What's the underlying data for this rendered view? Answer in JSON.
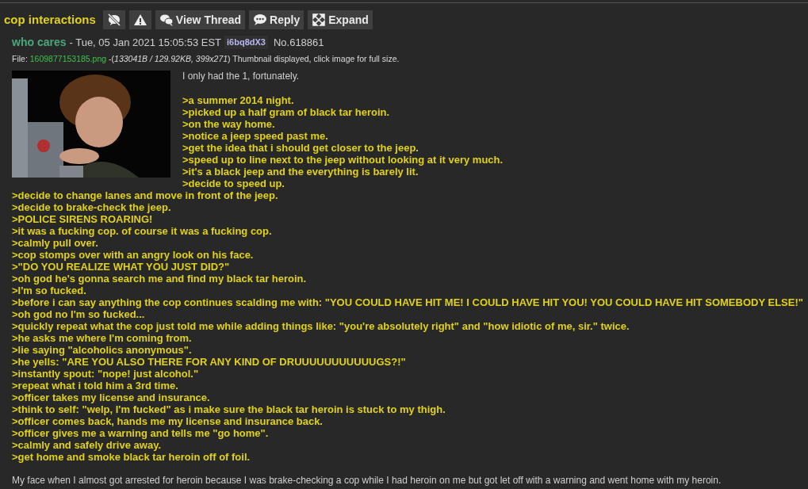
{
  "thread_title": "cop interactions",
  "buttons": [
    {
      "kind": "hide"
    },
    {
      "kind": "report"
    },
    {
      "kind": "thread",
      "label": "View Thread"
    },
    {
      "kind": "reply",
      "label": "Reply"
    },
    {
      "kind": "expand",
      "label": "Expand"
    }
  ],
  "post": {
    "name": "who cares",
    "date": "- Tue, 05 Jan 2021 15:05:53 EST",
    "poster_id": "i6bq8dX3",
    "number": "No.618861",
    "file": {
      "prefix": "File: ",
      "filename": "1609877153185.png",
      "info": "-(*133041B / 129.92KB, 399x271*) Thumbnail displayed, click image for full size."
    },
    "lines": [
      {
        "kind": "text",
        "text": "I only had the 1, fortunately."
      },
      {
        "kind": "blank"
      },
      {
        "kind": "quote",
        "text": ">a summer 2014 night."
      },
      {
        "kind": "quote",
        "text": ">picked up a half gram of black tar heroin."
      },
      {
        "kind": "quote",
        "text": ">on the way home."
      },
      {
        "kind": "quote",
        "text": ">notice a jeep speed past me."
      },
      {
        "kind": "quote",
        "text": ">get the idea that i should get closer to the jeep."
      },
      {
        "kind": "quote",
        "text": ">speed up to line next to the jeep without looking at it very much."
      },
      {
        "kind": "quote",
        "text": ">it's a black jeep and the everything is barely lit."
      },
      {
        "kind": "quote",
        "text": ">decide to speed up."
      },
      {
        "kind": "quote",
        "text": ">decide to change lanes and move in front of the jeep."
      },
      {
        "kind": "quote",
        "text": ">decide to brake-check the jeep."
      },
      {
        "kind": "quote",
        "text": ">POLICE SIRENS ROARING!"
      },
      {
        "kind": "quote",
        "text": ">it was a fucking cop. of course it was a fucking cop."
      },
      {
        "kind": "quote",
        "text": ">calmly pull over."
      },
      {
        "kind": "quote",
        "text": ">cop stomps over with an angry look on his face."
      },
      {
        "kind": "quote",
        "text": ">\"DO YOU REALIZE WHAT YOU JUST DID?\""
      },
      {
        "kind": "quote",
        "text": ">oh god he's gonna search me and find my black tar heroin."
      },
      {
        "kind": "quote",
        "text": ">I'm so fucked."
      },
      {
        "kind": "quote",
        "text": ">before i can say anything the cop continues scalding me with: \"YOU COULD HAVE HIT ME! I COULD HAVE HIT YOU! YOU COULD HAVE HIT SOMEBODY ELSE!\""
      },
      {
        "kind": "quote",
        "text": ">oh god no I'm so fucked..."
      },
      {
        "kind": "quote",
        "text": ">quickly repeat what the cop just told me while adding things like: \"you're absolutely right\" and \"how idiotic of me, sir.\" twice."
      },
      {
        "kind": "quote",
        "text": ">he asks me where I'm coming from."
      },
      {
        "kind": "quote",
        "text": ">lie saying \"alcoholics anonymous\"."
      },
      {
        "kind": "quote",
        "text": ">he yells: \"ARE YOU ALSO THERE FOR ANY KIND OF DRUUUUUUUUUUUGS?!\""
      },
      {
        "kind": "quote",
        "text": ">instantly spout: \"nope! just alcohol.\""
      },
      {
        "kind": "quote",
        "text": ">repeat what i told him a 3rd time."
      },
      {
        "kind": "quote",
        "text": ">officer takes my license and insurance."
      },
      {
        "kind": "quote",
        "text": ">think to self: \"welp, I'm fucked\" as i make sure the black tar heroin is stuck to my thigh."
      },
      {
        "kind": "quote",
        "text": ">officer comes back, hands me my license and insurance back."
      },
      {
        "kind": "quote",
        "text": ">officer gives me a warning and tells me \"go home\"."
      },
      {
        "kind": "quote",
        "text": ">calmly and safely drive away."
      },
      {
        "kind": "quote",
        "text": ">get home and smoke black tar heroin off of foil."
      },
      {
        "kind": "blank"
      },
      {
        "kind": "text",
        "text": "My face when I almost got arrested for heroin because I was brake-checking a cop while I had heroin on me but got let off with a warning and went home with my heroin."
      }
    ]
  }
}
